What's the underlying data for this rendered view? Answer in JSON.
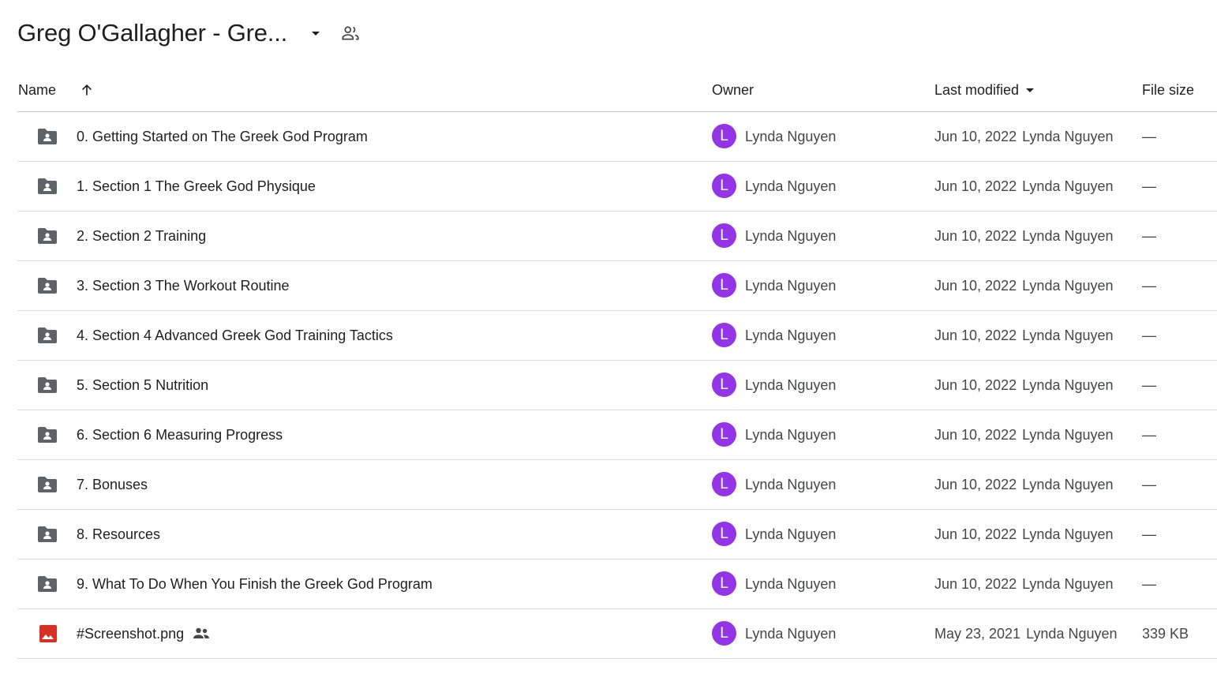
{
  "folder_title": "Greg O'Gallagher - Gre...",
  "columns": {
    "name": "Name",
    "owner": "Owner",
    "last_modified": "Last modified",
    "file_size": "File size"
  },
  "sort": {
    "column": "name",
    "direction": "ascending"
  },
  "files": [
    {
      "name": "0. Getting Started on The Greek God Program",
      "type": "shared-folder",
      "owner_initial": "L",
      "owner": "Lynda Nguyen",
      "modified_date": "Jun 10, 2022",
      "modified_by": "Lynda Nguyen",
      "size": "—",
      "shared": false
    },
    {
      "name": "1. Section 1 The Greek God Physique",
      "type": "shared-folder",
      "owner_initial": "L",
      "owner": "Lynda Nguyen",
      "modified_date": "Jun 10, 2022",
      "modified_by": "Lynda Nguyen",
      "size": "—",
      "shared": false
    },
    {
      "name": "2. Section 2 Training",
      "type": "shared-folder",
      "owner_initial": "L",
      "owner": "Lynda Nguyen",
      "modified_date": "Jun 10, 2022",
      "modified_by": "Lynda Nguyen",
      "size": "—",
      "shared": false
    },
    {
      "name": "3. Section 3 The Workout Routine",
      "type": "shared-folder",
      "owner_initial": "L",
      "owner": "Lynda Nguyen",
      "modified_date": "Jun 10, 2022",
      "modified_by": "Lynda Nguyen",
      "size": "—",
      "shared": false
    },
    {
      "name": "4. Section 4 Advanced Greek God Training Tactics",
      "type": "shared-folder",
      "owner_initial": "L",
      "owner": "Lynda Nguyen",
      "modified_date": "Jun 10, 2022",
      "modified_by": "Lynda Nguyen",
      "size": "—",
      "shared": false
    },
    {
      "name": "5. Section 5 Nutrition",
      "type": "shared-folder",
      "owner_initial": "L",
      "owner": "Lynda Nguyen",
      "modified_date": "Jun 10, 2022",
      "modified_by": "Lynda Nguyen",
      "size": "—",
      "shared": false
    },
    {
      "name": "6. Section 6 Measuring Progress",
      "type": "shared-folder",
      "owner_initial": "L",
      "owner": "Lynda Nguyen",
      "modified_date": "Jun 10, 2022",
      "modified_by": "Lynda Nguyen",
      "size": "—",
      "shared": false
    },
    {
      "name": "7. Bonuses",
      "type": "shared-folder",
      "owner_initial": "L",
      "owner": "Lynda Nguyen",
      "modified_date": "Jun 10, 2022",
      "modified_by": "Lynda Nguyen",
      "size": "—",
      "shared": false
    },
    {
      "name": "8. Resources",
      "type": "shared-folder",
      "owner_initial": "L",
      "owner": "Lynda Nguyen",
      "modified_date": "Jun 10, 2022",
      "modified_by": "Lynda Nguyen",
      "size": "—",
      "shared": false
    },
    {
      "name": "9. What To Do When You Finish the Greek God Program",
      "type": "shared-folder",
      "owner_initial": "L",
      "owner": "Lynda Nguyen",
      "modified_date": "Jun 10, 2022",
      "modified_by": "Lynda Nguyen",
      "size": "—",
      "shared": false
    },
    {
      "name": "#Screenshot.png",
      "type": "image",
      "owner_initial": "L",
      "owner": "Lynda Nguyen",
      "modified_date": "May 23, 2021",
      "modified_by": "Lynda Nguyen",
      "size": "339 KB",
      "shared": true
    }
  ],
  "icons": {
    "title_dropdown": "arrow-drop-down-icon",
    "title_shared": "people-outline-icon",
    "sort_arrow": "arrow-upward-icon",
    "modified_dropdown": "arrow-drop-down-icon",
    "shared_folder": "folder-shared-icon",
    "image_file": "image-file-icon",
    "shared_badge": "people-icon"
  },
  "colors": {
    "avatar": "#9334e6",
    "folder_icon": "#5f6368",
    "image_icon": "#d93025",
    "divider": "#dadce0"
  }
}
